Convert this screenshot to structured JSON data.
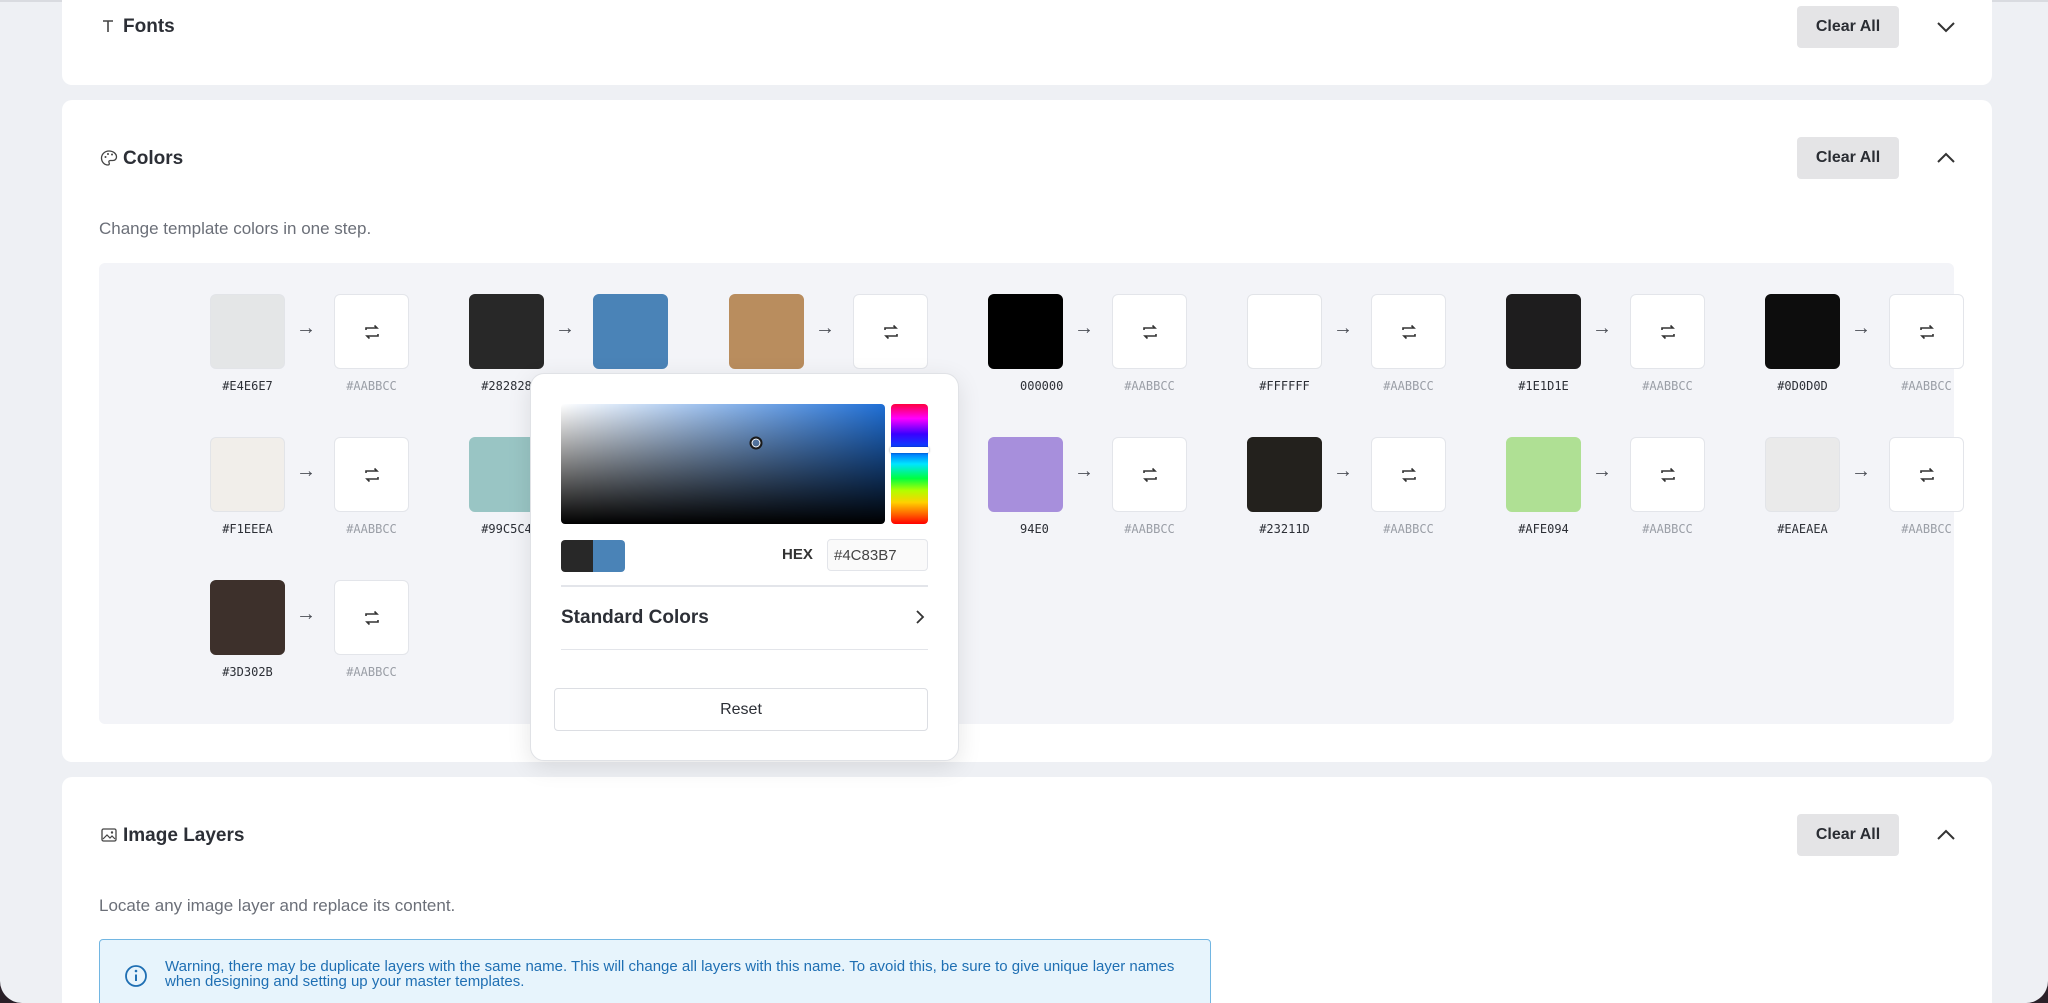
{
  "fonts": {
    "title": "Fonts",
    "clear_label": "Clear All"
  },
  "colors": {
    "title": "Colors",
    "clear_label": "Clear All",
    "subtitle": "Change template colors in one step.",
    "pairs": [
      {
        "from": "#E4E6E7",
        "to": "#AABBCC"
      },
      {
        "from": "#282828",
        "to": ""
      },
      {
        "from": "",
        "to": ""
      },
      {
        "from": "000000",
        "to": "#AABBCC"
      },
      {
        "from": "#FFFFFF",
        "to": "#AABBCC"
      },
      {
        "from": "#1E1D1E",
        "to": "#AABBCC"
      },
      {
        "from": "#0D0D0D",
        "to": "#AABBCC"
      },
      {
        "from": "#F1EEEA",
        "to": "#AABBCC"
      },
      {
        "from": "#99C5C4",
        "to": ""
      },
      {
        "from": "",
        "to": ""
      },
      {
        "from": "94E0",
        "to": "#AABBCC"
      },
      {
        "from": "#23211D",
        "to": "#AABBCC"
      },
      {
        "from": "#AFE094",
        "to": "#AABBCC"
      },
      {
        "from": "#EAEAEA",
        "to": "#AABBCC"
      },
      {
        "from": "#3D302B",
        "to": "#AABBCC"
      }
    ],
    "swatch_colors": [
      "#E4E6E7",
      "#282828",
      "#B98D5E",
      "#000000",
      "#FFFFFF",
      "#1E1D1E",
      "#0D0D0D",
      "#F1EEEA",
      "#99C5C4",
      "#A78FDC",
      "#23211D",
      "#AFE094",
      "#EAEAEA",
      "#3D302B"
    ],
    "selected_target_color": "#4A83B7"
  },
  "picker": {
    "hex_label": "HEX",
    "hex_value": "#4C83B7",
    "standard_colors_label": "Standard Colors",
    "reset_label": "Reset"
  },
  "image_layers": {
    "title": "Image Layers",
    "clear_label": "Clear All",
    "subtitle": "Locate any image layer and replace its content.",
    "warning": "Warning, there may be duplicate layers with the same name. This will change all layers with this name. To avoid this, be sure to give unique layer names when designing and setting up your master templates."
  }
}
